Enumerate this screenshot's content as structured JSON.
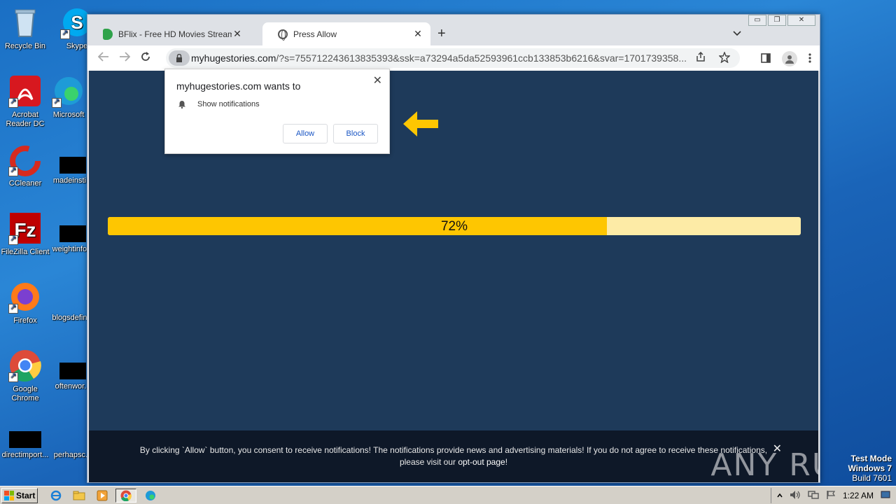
{
  "desktop": {
    "icons": [
      {
        "label": "Recycle Bin"
      },
      {
        "label": "Skype"
      },
      {
        "label": "Acrobat Reader DC"
      },
      {
        "label": "Microsoft"
      },
      {
        "label": "CCleaner"
      },
      {
        "label": "madeinsti..."
      },
      {
        "label": "FileZilla Client"
      },
      {
        "label": "weightinfo..."
      },
      {
        "label": "Firefox"
      },
      {
        "label": "blogsdefin..."
      },
      {
        "label": "Google Chrome"
      },
      {
        "label": "oftenwor..."
      },
      {
        "label": "directimport..."
      },
      {
        "label": "perhapsc..."
      }
    ],
    "test_mode": {
      "line1": "Test Mode",
      "line2": "Windows 7",
      "line3": "Build 7601"
    }
  },
  "browser": {
    "tabs": [
      {
        "title": "BFlix - Free HD Movies Streaming - W",
        "close": "✕"
      },
      {
        "title": "Press Allow",
        "close": "✕"
      }
    ],
    "new_tab": "+",
    "url_host": "myhugestories.com",
    "url_rest": "/?s=755712243613835393&ssk=a73294a5da52593961ccb133853b6216&svar=1701739358...",
    "window_controls": [
      "▭",
      "❐",
      "✕"
    ]
  },
  "page": {
    "progress_label": "72%",
    "progress_fraction": 0.72,
    "footer_text": "By clicking `Allow` button, you consent to receive notifications! The notifications provide news and advertising materials! If you do not agree to receive these notifications,",
    "footer_text2": "please visit our ",
    "footer_link": "opt-out page",
    "footer_text3": "!",
    "footer_close": "✕",
    "watermark": "ANY RUN"
  },
  "popup": {
    "title": "myhugestories.com wants to",
    "permission": "Show notifications",
    "allow": "Allow",
    "block": "Block",
    "close": "✕"
  },
  "taskbar": {
    "start": "Start",
    "clock": "1:22 AM"
  },
  "colors": {
    "page_bg": "#1e3a5a",
    "progress_fill": "#fec601",
    "progress_track": "#fdeba6",
    "arrow": "#fec601"
  }
}
